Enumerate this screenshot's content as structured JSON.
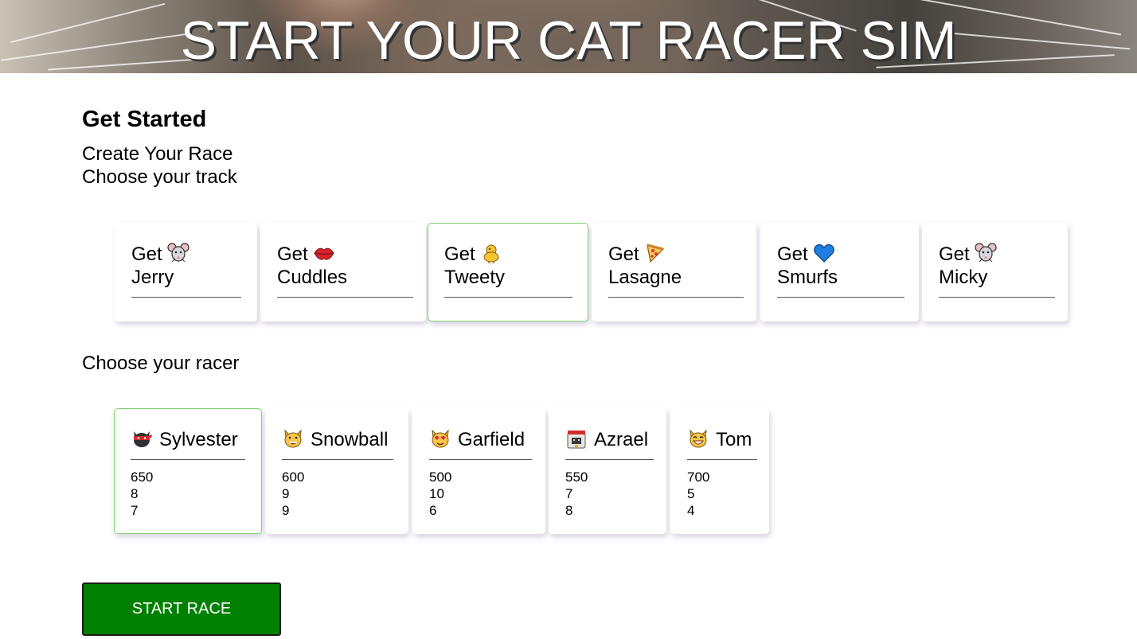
{
  "header": {
    "title": "START YOUR CAT RACER SIM"
  },
  "intro": {
    "heading": "Get Started",
    "create_label": "Create Your Race",
    "track_prompt": "Choose your track",
    "racer_prompt": "Choose your racer"
  },
  "tracks": [
    {
      "prefix": "Get",
      "name": "Jerry",
      "icon": "mouse-icon",
      "selected": false
    },
    {
      "prefix": "Get",
      "name": "Cuddles",
      "icon": "kiss-lips-icon",
      "selected": false
    },
    {
      "prefix": "Get",
      "name": "Tweety",
      "icon": "chick-icon",
      "selected": true
    },
    {
      "prefix": "Get",
      "name": "Lasagne",
      "icon": "pizza-icon",
      "selected": false
    },
    {
      "prefix": "Get",
      "name": "Smurfs",
      "icon": "blue-heart-icon",
      "selected": false
    },
    {
      "prefix": "Get",
      "name": "Micky",
      "icon": "mouse-icon",
      "selected": false
    }
  ],
  "racers": [
    {
      "name": "Sylvester",
      "icon": "ninja-cat-icon",
      "stats": [
        "650",
        "8",
        "7"
      ],
      "selected": true
    },
    {
      "name": "Snowball",
      "icon": "grinning-cat-icon",
      "stats": [
        "600",
        "9",
        "9"
      ],
      "selected": false
    },
    {
      "name": "Garfield",
      "icon": "heart-eyes-cat-icon",
      "stats": [
        "500",
        "10",
        "6"
      ],
      "selected": false
    },
    {
      "name": "Azrael",
      "icon": "astro-cat-icon",
      "stats": [
        "550",
        "7",
        "8"
      ],
      "selected": false
    },
    {
      "name": "Tom",
      "icon": "smiling-cat-icon",
      "stats": [
        "700",
        "5",
        "4"
      ],
      "selected": false
    }
  ],
  "actions": {
    "start_label": "START RACE"
  },
  "colors": {
    "accent_green": "#008000",
    "selected_border": "#7bd36b"
  }
}
